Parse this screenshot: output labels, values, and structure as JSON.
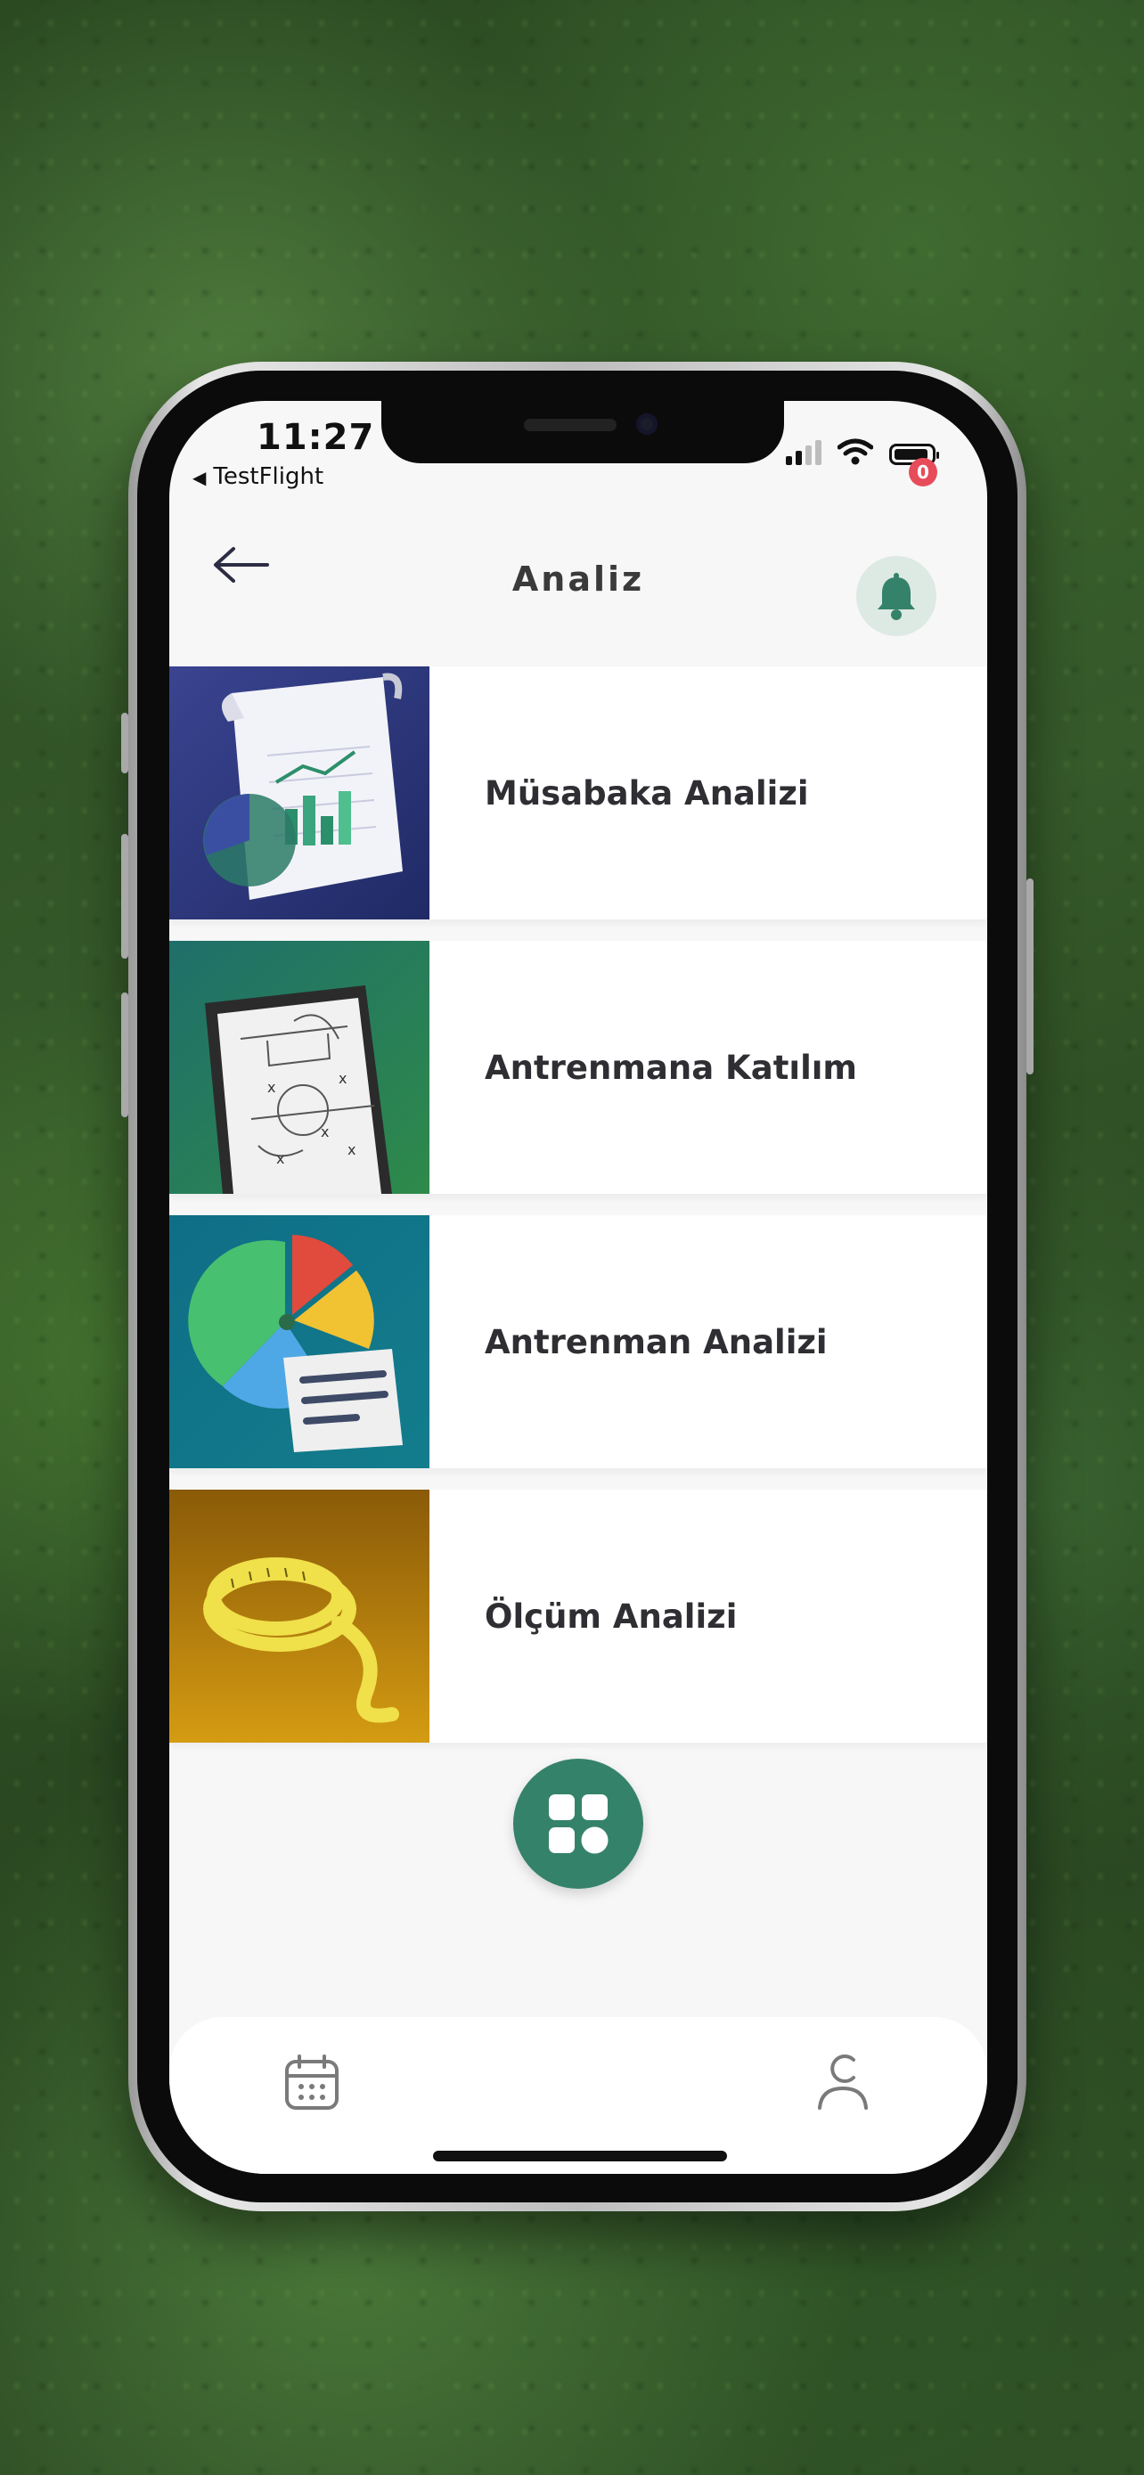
{
  "status_bar": {
    "time": "11:27",
    "back_app": "TestFlight"
  },
  "header": {
    "title": "Analiz",
    "notification_count": "0",
    "back_icon": "arrow-left-icon",
    "bell_icon": "bell-icon"
  },
  "menu": [
    {
      "label": "Müsabaka Analizi",
      "image": "chart-document-illustration"
    },
    {
      "label": "Antrenmana Katılım",
      "image": "tactics-board-illustration"
    },
    {
      "label": "Antrenman Analizi",
      "image": "pie-chart-report-illustration"
    },
    {
      "label": "Ölçüm Analizi",
      "image": "measuring-tape-illustration"
    }
  ],
  "tab_bar": {
    "left_icon": "calendar-icon",
    "center_icon": "grid-apps-icon",
    "right_icon": "user-icon"
  },
  "colors": {
    "accent": "#35826a",
    "badge": "#e74c5a",
    "bell_bg": "#dde9e3"
  }
}
